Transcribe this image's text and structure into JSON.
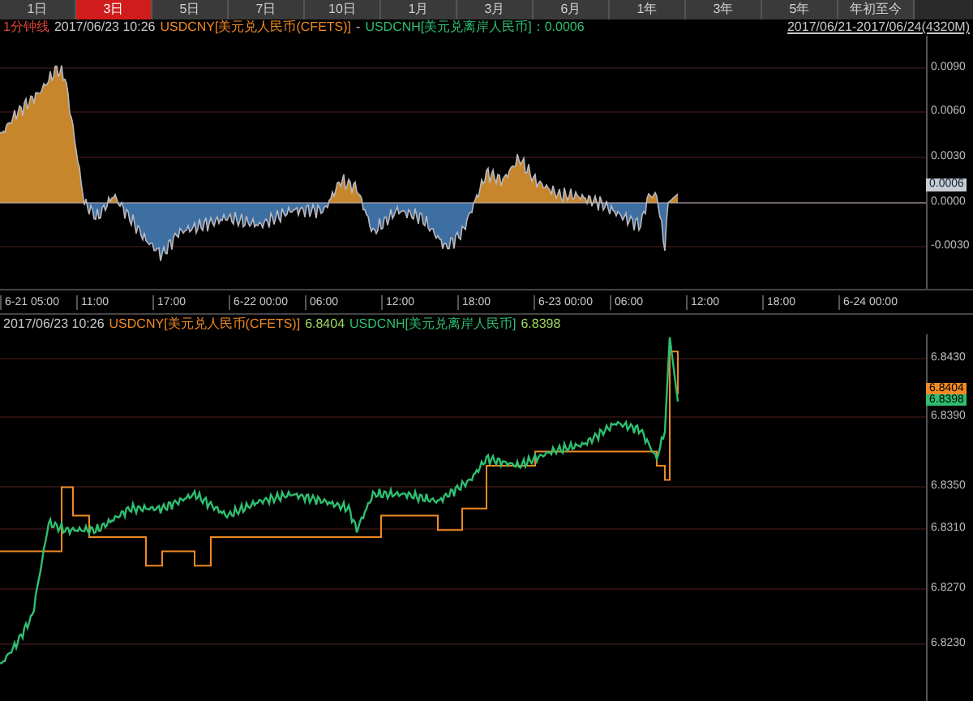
{
  "tabs": [
    {
      "label": "1日",
      "selected": false
    },
    {
      "label": "3日",
      "selected": true
    },
    {
      "label": "5日",
      "selected": false
    },
    {
      "label": "7日",
      "selected": false
    },
    {
      "label": "10日",
      "selected": false
    },
    {
      "label": "1月",
      "selected": false
    },
    {
      "label": "3月",
      "selected": false
    },
    {
      "label": "6月",
      "selected": false
    },
    {
      "label": "1年",
      "selected": false
    },
    {
      "label": "3年",
      "selected": false
    },
    {
      "label": "5年",
      "selected": false
    },
    {
      "label": "年初至今",
      "selected": false
    }
  ],
  "spread_panel": {
    "interval": "1分钟线",
    "datetime": "2017/06/23 10:26",
    "series_a": "USDCNY[美元兑人民币(CFETS)]",
    "separator": "-",
    "series_b": "USDCNH[美元兑离岸人民币]：0.0006",
    "range": "2017/06/21-2017/06/24(4320M)",
    "y_ticks": [
      "0.0090",
      "0.0060",
      "0.0030",
      "0.0000",
      "-0.0030"
    ],
    "current_marker": "0.0006"
  },
  "time_axis": [
    "6-21 05:00",
    "11:00",
    "17:00",
    "6-22 00:00",
    "06:00",
    "12:00",
    "18:00",
    "6-23 00:00",
    "06:00",
    "12:00",
    "18:00",
    "6-24 00:00"
  ],
  "price_panel": {
    "datetime": "2017/06/23 10:26",
    "series": [
      {
        "label": "USDCNY[美元兑人民币(CFETS)]",
        "value": "6.8404",
        "color": "#f08a24"
      },
      {
        "label": "USDCNH[美元兑离岸人民币]",
        "value": "6.8398",
        "color": "#2fbf71"
      }
    ],
    "y_ticks": [
      "6.8430",
      "6.8390",
      "6.8350",
      "6.8310",
      "6.8270",
      "6.8230"
    ],
    "markers": [
      {
        "value": "6.8404",
        "color": "#f08a24"
      },
      {
        "value": "6.8398",
        "color": "#2fbf71"
      }
    ]
  }
}
